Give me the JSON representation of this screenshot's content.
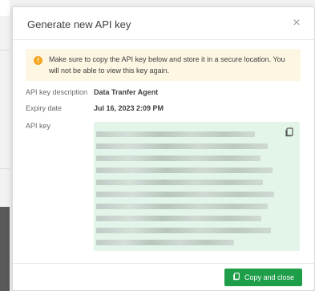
{
  "dialog": {
    "title": "Generate new API key",
    "close_icon": "close-icon",
    "close_glyph": "×"
  },
  "warning": {
    "icon": "warning-icon",
    "icon_glyph": "!",
    "text": "Make sure to copy the API key below and store it in a secure location. You will not be able to view this key again."
  },
  "fields": {
    "description_label": "API key description",
    "description_value": "Data Tranfer Agent",
    "expiry_label": "Expiry date",
    "expiry_value": "Jul 16, 2023 2:09 PM",
    "key_label": "API key"
  },
  "key_box": {
    "copy_icon": "copy-icon"
  },
  "footer": {
    "copy_close_label": "Copy and close",
    "copy_close_icon": "copy-icon"
  },
  "colors": {
    "accent": "#1f9e4a",
    "warning_bg": "#fdf6e3",
    "warning_icon": "#f5a623",
    "key_bg": "#e3f4e9"
  }
}
